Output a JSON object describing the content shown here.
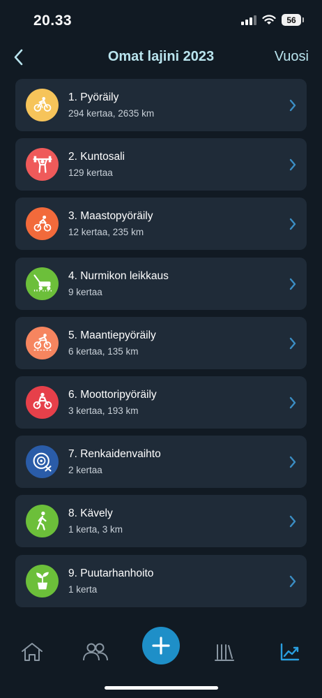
{
  "status": {
    "time": "20.33",
    "battery": "56"
  },
  "nav": {
    "title": "Omat lajini 2023",
    "right_label": "Vuosi"
  },
  "activities": [
    {
      "title": "1. Pyöräily",
      "subtitle": "294 kertaa, 2635 km",
      "color": "#f6c45a",
      "icon": "bicycle-icon"
    },
    {
      "title": "2. Kuntosali",
      "subtitle": "129 kertaa",
      "color": "#ef5a5a",
      "icon": "weightlifting-icon"
    },
    {
      "title": "3. Maastopyöräily",
      "subtitle": "12 kertaa, 235 km",
      "color": "#f26a3b",
      "icon": "mountain-bike-icon"
    },
    {
      "title": "4. Nurmikon leikkaus",
      "subtitle": "9 kertaa",
      "color": "#6cbf3a",
      "icon": "lawn-mower-icon"
    },
    {
      "title": "5. Maantiepyöräily",
      "subtitle": "6 kertaa, 135 km",
      "color": "#f6855f",
      "icon": "road-bike-icon"
    },
    {
      "title": "6. Moottoripyöräily",
      "subtitle": "3 kertaa, 193 km",
      "color": "#e6404a",
      "icon": "motorcycle-icon"
    },
    {
      "title": "7. Renkaidenvaihto",
      "subtitle": "2 kertaa",
      "color": "#2a5ca8",
      "icon": "tire-change-icon"
    },
    {
      "title": "8. Kävely",
      "subtitle": "1 kerta, 3 km",
      "color": "#6cbf3a",
      "icon": "walking-icon"
    },
    {
      "title": "9. Puutarhanhoito",
      "subtitle": "1 kerta",
      "color": "#6cbf3a",
      "icon": "plant-icon"
    }
  ],
  "tabs": [
    {
      "name": "home",
      "icon": "home-icon",
      "active": false
    },
    {
      "name": "friends",
      "icon": "people-icon",
      "active": false
    },
    {
      "name": "add",
      "icon": "plus-icon",
      "active": false
    },
    {
      "name": "diary",
      "icon": "books-icon",
      "active": false
    },
    {
      "name": "stats",
      "icon": "trend-chart-icon",
      "active": true
    }
  ],
  "colors": {
    "background": "#111a23",
    "card": "#1f2b38",
    "accent": "#1e8fc8",
    "title": "#b9e4ee"
  }
}
